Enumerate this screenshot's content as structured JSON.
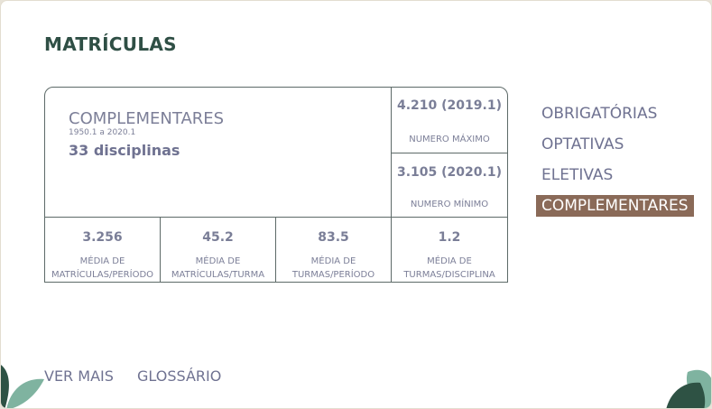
{
  "section": {
    "title": "MATRÍCULAS"
  },
  "summary": {
    "category": "COMPLEMENTARES",
    "period": "1950.1 a 2020.1",
    "disciplines": "33 disciplinas"
  },
  "side_stats": [
    {
      "value": "4.210 (2019.1)",
      "label": "NUMERO MÁXIMO"
    },
    {
      "value": "3.105 (2020.1)",
      "label": "NUMERO MÍNIMO"
    }
  ],
  "bottom_stats": [
    {
      "value": "3.256",
      "label_line1": "MÉDIA DE",
      "label_line2": "MATRÍCULAS/PERÍODO"
    },
    {
      "value": "45.2",
      "label_line1": "MÉDIA DE",
      "label_line2": "MATRÍCULAS/TURMA"
    },
    {
      "value": "83.5",
      "label_line1": "MÉDIA DE",
      "label_line2": "TURMAS/PERÍODO"
    },
    {
      "value": "1.2",
      "label_line1": "MÉDIA DE",
      "label_line2": "TURMAS/DISCIPLINA"
    }
  ],
  "nav": {
    "items": [
      {
        "label": "OBRIGATÓRIAS",
        "active": false
      },
      {
        "label": "OPTATIVAS",
        "active": false
      },
      {
        "label": "ELETIVAS",
        "active": false
      },
      {
        "label": "COMPLEMENTARES",
        "active": true
      }
    ]
  },
  "footer": {
    "see_more": "VER MAIS",
    "glossary": "GLOSSÁRIO"
  },
  "colors": {
    "title": "#2f4f45",
    "text": "#6f7291",
    "active_bg": "#8a6a58",
    "leaf_dark": "#2e5244",
    "leaf_light": "#7fb3a0"
  }
}
